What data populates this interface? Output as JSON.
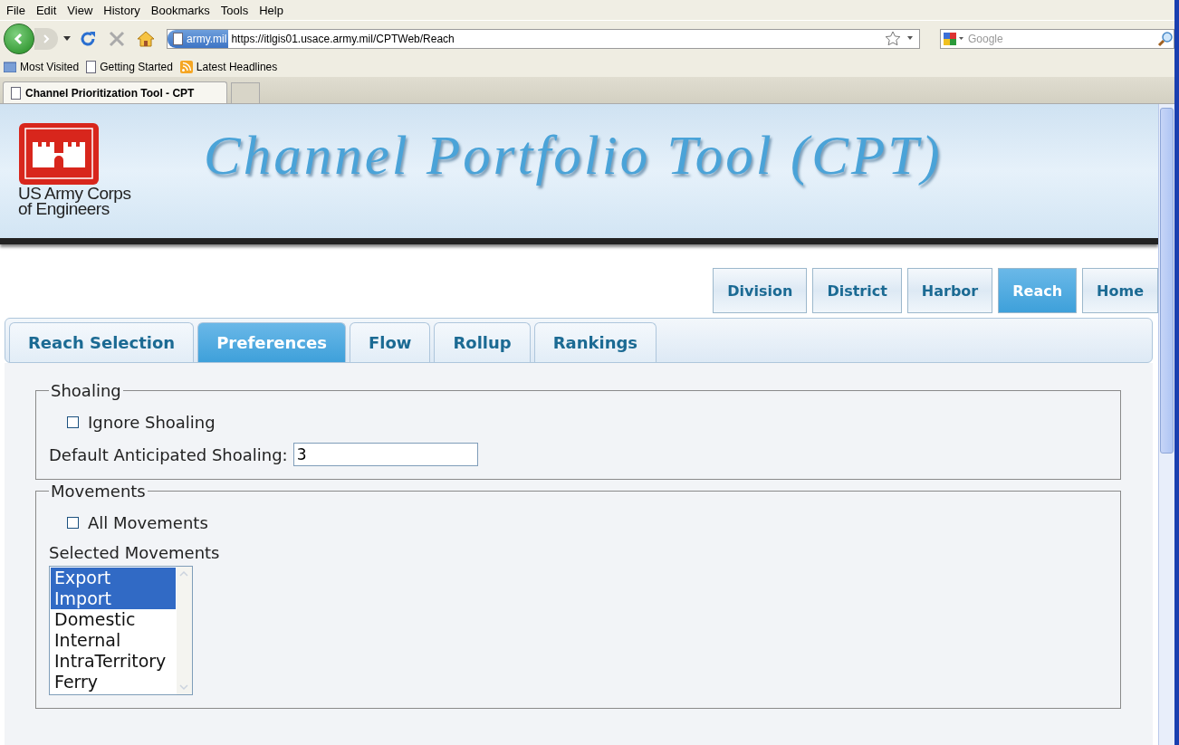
{
  "menu": [
    "File",
    "Edit",
    "View",
    "History",
    "Bookmarks",
    "Tools",
    "Help"
  ],
  "address": {
    "site": "army.mil",
    "url": "https://itlgis01.usace.army.mil/CPTWeb/Reach"
  },
  "search": {
    "placeholder": "Google"
  },
  "bookmarks": [
    {
      "kind": "folder",
      "label": "Most Visited"
    },
    {
      "kind": "page",
      "label": "Getting Started"
    },
    {
      "kind": "feed",
      "label": "Latest Headlines"
    }
  ],
  "browser_tabs": [
    {
      "label": "Channel Prioritization Tool - CPT",
      "selected": true
    }
  ],
  "banner": {
    "org_line1": "US Army Corps",
    "org_line2": "of Engineers",
    "title": "Channel Portfolio Tool (CPT)"
  },
  "nav": [
    {
      "label": "Division",
      "selected": false
    },
    {
      "label": "District",
      "selected": false
    },
    {
      "label": "Harbor",
      "selected": false
    },
    {
      "label": "Reach",
      "selected": true
    },
    {
      "label": "Home",
      "selected": false
    }
  ],
  "tabs": [
    {
      "label": "Reach Selection",
      "selected": false
    },
    {
      "label": "Preferences",
      "selected": true
    },
    {
      "label": "Flow",
      "selected": false
    },
    {
      "label": "Rollup",
      "selected": false
    },
    {
      "label": "Rankings",
      "selected": false
    }
  ],
  "shoaling": {
    "legend": "Shoaling",
    "ignore": {
      "label": "Ignore Shoaling",
      "checked": false
    },
    "default_label": "Default Anticipated Shoaling:",
    "default_value": "3"
  },
  "movements": {
    "legend": "Movements",
    "all": {
      "label": "All Movements",
      "checked": false
    },
    "list_label": "Selected Movements",
    "options": [
      {
        "label": "Export",
        "selected": true
      },
      {
        "label": "Import",
        "selected": true
      },
      {
        "label": "Domestic",
        "selected": false
      },
      {
        "label": "Internal",
        "selected": false
      },
      {
        "label": "IntraTerritory",
        "selected": false
      },
      {
        "label": "Ferry",
        "selected": false
      }
    ]
  }
}
